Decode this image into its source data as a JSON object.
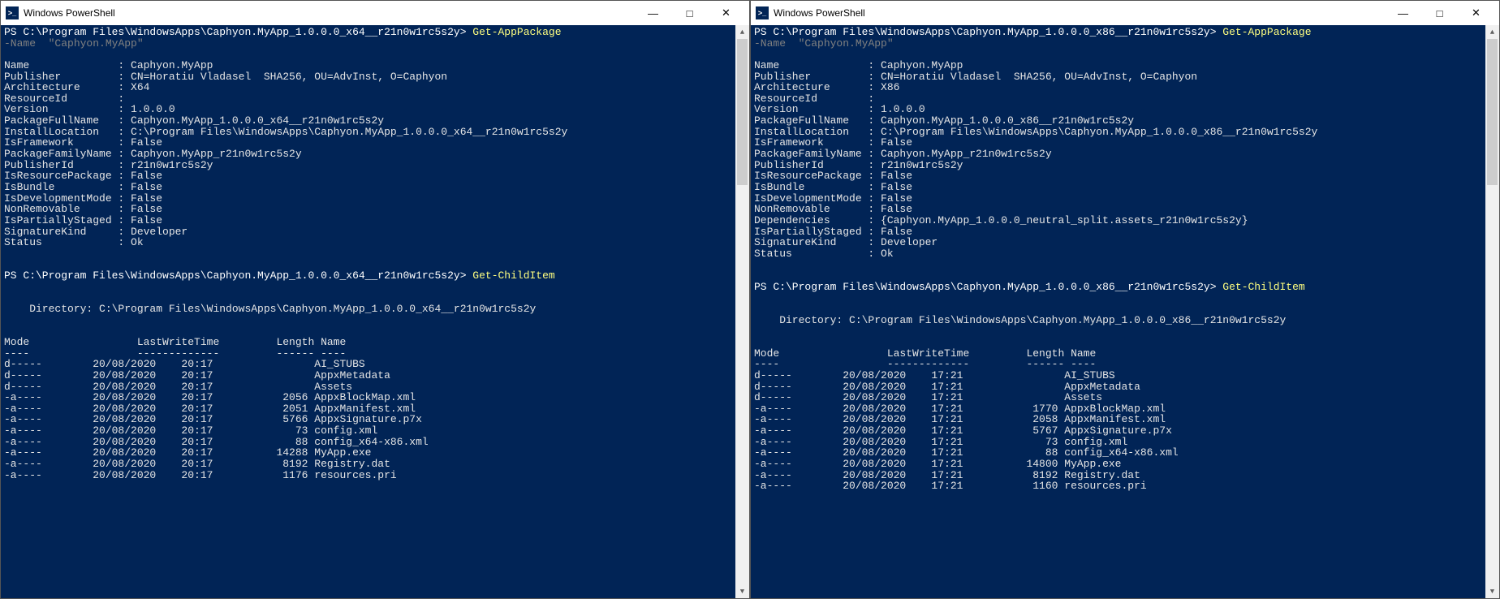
{
  "left": {
    "title": "Windows PowerShell",
    "prompt_path": "C:\\Program Files\\WindowsApps\\Caphyon.MyApp_1.0.0.0_x64__r21n0w1rc5s2y",
    "cmd1": "Get-AppPackage",
    "cmd1_line2a": "-Name",
    "cmd1_line2b": "\"Caphyon.MyApp\"",
    "props": [
      [
        "Name",
        "Caphyon.MyApp"
      ],
      [
        "Publisher",
        "CN=Horatiu Vladasel  SHA256, OU=AdvInst, O=Caphyon"
      ],
      [
        "Architecture",
        "X64"
      ],
      [
        "ResourceId",
        ""
      ],
      [
        "Version",
        "1.0.0.0"
      ],
      [
        "PackageFullName",
        "Caphyon.MyApp_1.0.0.0_x64__r21n0w1rc5s2y"
      ],
      [
        "InstallLocation",
        "C:\\Program Files\\WindowsApps\\Caphyon.MyApp_1.0.0.0_x64__r21n0w1rc5s2y"
      ],
      [
        "IsFramework",
        "False"
      ],
      [
        "PackageFamilyName",
        "Caphyon.MyApp_r21n0w1rc5s2y"
      ],
      [
        "PublisherId",
        "r21n0w1rc5s2y"
      ],
      [
        "IsResourcePackage",
        "False"
      ],
      [
        "IsBundle",
        "False"
      ],
      [
        "IsDevelopmentMode",
        "False"
      ],
      [
        "NonRemovable",
        "False"
      ],
      [
        "IsPartiallyStaged",
        "False"
      ],
      [
        "SignatureKind",
        "Developer"
      ],
      [
        "Status",
        "Ok"
      ]
    ],
    "cmd2": "Get-ChildItem",
    "dir_label": "    Directory: C:\\Program Files\\WindowsApps\\Caphyon.MyApp_1.0.0.0_x64__r21n0w1rc5s2y",
    "header": "Mode                 LastWriteTime         Length Name",
    "divider": "----                 -------------         ------ ----",
    "rows": [
      [
        "d-----",
        "20/08/2020",
        "20:17",
        "",
        "AI_STUBS"
      ],
      [
        "d-----",
        "20/08/2020",
        "20:17",
        "",
        "AppxMetadata"
      ],
      [
        "d-----",
        "20/08/2020",
        "20:17",
        "",
        "Assets"
      ],
      [
        "-a----",
        "20/08/2020",
        "20:17",
        "2056",
        "AppxBlockMap.xml"
      ],
      [
        "-a----",
        "20/08/2020",
        "20:17",
        "2051",
        "AppxManifest.xml"
      ],
      [
        "-a----",
        "20/08/2020",
        "20:17",
        "5766",
        "AppxSignature.p7x"
      ],
      [
        "-a----",
        "20/08/2020",
        "20:17",
        "73",
        "config.xml"
      ],
      [
        "-a----",
        "20/08/2020",
        "20:17",
        "88",
        "config_x64-x86.xml"
      ],
      [
        "-a----",
        "20/08/2020",
        "20:17",
        "14288",
        "MyApp.exe"
      ],
      [
        "-a----",
        "20/08/2020",
        "20:17",
        "8192",
        "Registry.dat"
      ],
      [
        "-a----",
        "20/08/2020",
        "20:17",
        "1176",
        "resources.pri"
      ]
    ]
  },
  "right": {
    "title": "Windows PowerShell",
    "prompt_path": "C:\\Program Files\\WindowsApps\\Caphyon.MyApp_1.0.0.0_x86__r21n0w1rc5s2y",
    "cmd1": "Get-AppPackage",
    "cmd1_line2a": "-Name",
    "cmd1_line2b": "\"Caphyon.MyApp\"",
    "props": [
      [
        "Name",
        "Caphyon.MyApp"
      ],
      [
        "Publisher",
        "CN=Horatiu Vladasel  SHA256, OU=AdvInst, O=Caphyon"
      ],
      [
        "Architecture",
        "X86"
      ],
      [
        "ResourceId",
        ""
      ],
      [
        "Version",
        "1.0.0.0"
      ],
      [
        "PackageFullName",
        "Caphyon.MyApp_1.0.0.0_x86__r21n0w1rc5s2y"
      ],
      [
        "InstallLocation",
        "C:\\Program Files\\WindowsApps\\Caphyon.MyApp_1.0.0.0_x86__r21n0w1rc5s2y"
      ],
      [
        "IsFramework",
        "False"
      ],
      [
        "PackageFamilyName",
        "Caphyon.MyApp_r21n0w1rc5s2y"
      ],
      [
        "PublisherId",
        "r21n0w1rc5s2y"
      ],
      [
        "IsResourcePackage",
        "False"
      ],
      [
        "IsBundle",
        "False"
      ],
      [
        "IsDevelopmentMode",
        "False"
      ],
      [
        "NonRemovable",
        "False"
      ],
      [
        "Dependencies",
        "{Caphyon.MyApp_1.0.0.0_neutral_split.assets_r21n0w1rc5s2y}"
      ],
      [
        "IsPartiallyStaged",
        "False"
      ],
      [
        "SignatureKind",
        "Developer"
      ],
      [
        "Status",
        "Ok"
      ]
    ],
    "cmd2": "Get-ChildItem",
    "dir_label": "    Directory: C:\\Program Files\\WindowsApps\\Caphyon.MyApp_1.0.0.0_x86__r21n0w1rc5s2y",
    "header": "Mode                 LastWriteTime         Length Name",
    "divider": "----                 -------------         ------ ----",
    "rows": [
      [
        "d-----",
        "20/08/2020",
        "17:21",
        "",
        "AI_STUBS"
      ],
      [
        "d-----",
        "20/08/2020",
        "17:21",
        "",
        "AppxMetadata"
      ],
      [
        "d-----",
        "20/08/2020",
        "17:21",
        "",
        "Assets"
      ],
      [
        "-a----",
        "20/08/2020",
        "17:21",
        "1770",
        "AppxBlockMap.xml"
      ],
      [
        "-a----",
        "20/08/2020",
        "17:21",
        "2058",
        "AppxManifest.xml"
      ],
      [
        "-a----",
        "20/08/2020",
        "17:21",
        "5767",
        "AppxSignature.p7x"
      ],
      [
        "-a----",
        "20/08/2020",
        "17:21",
        "73",
        "config.xml"
      ],
      [
        "-a----",
        "20/08/2020",
        "17:21",
        "88",
        "config_x64-x86.xml"
      ],
      [
        "-a----",
        "20/08/2020",
        "17:21",
        "14800",
        "MyApp.exe"
      ],
      [
        "-a----",
        "20/08/2020",
        "17:21",
        "8192",
        "Registry.dat"
      ],
      [
        "-a----",
        "20/08/2020",
        "17:21",
        "1160",
        "resources.pri"
      ]
    ]
  },
  "ps_prefix": "PS ",
  "prompt_suffix": "> "
}
